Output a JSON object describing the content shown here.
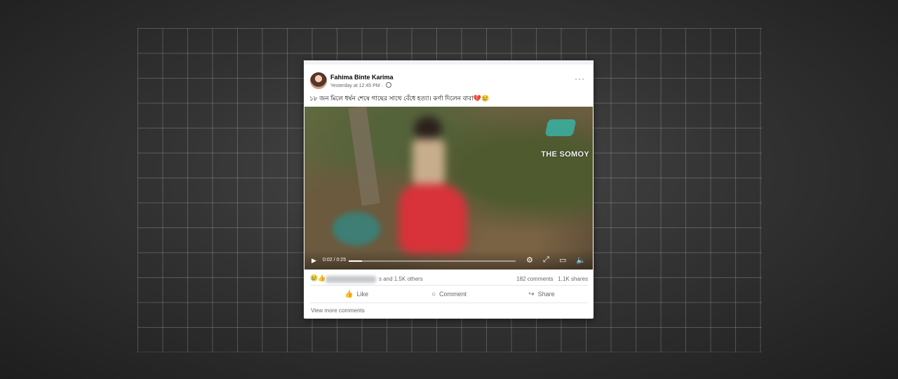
{
  "post": {
    "author": "Fahima Binte Karima",
    "timestamp": "Yesterday at 12:45 PM · ",
    "visibility_icon": "globe-icon",
    "caption": "১৮ জন মিলে ধর্ষন শেষে গাছের সাথে বেঁধে হত্যা। কর্ণা দিলেন বাবা💔😢",
    "more_icon": "···"
  },
  "video": {
    "watermark": "THE SOMOY",
    "time": "0:02 / 0:25",
    "progress": 0.08,
    "icons": {
      "play": "▶",
      "settings": "⚙",
      "fullscreen": "⤢",
      "pip": "▭",
      "volume": "🔈"
    }
  },
  "reactions": {
    "icons": "😢👍",
    "tail": "s and 1.5K others",
    "comments": "182 comments",
    "shares": "1.1K shares"
  },
  "actions": [
    {
      "label": "Like",
      "icon": "👍"
    },
    {
      "label": "Comment",
      "icon": "○"
    },
    {
      "label": "Share",
      "icon": "↪"
    }
  ],
  "view_more": "View more comments"
}
